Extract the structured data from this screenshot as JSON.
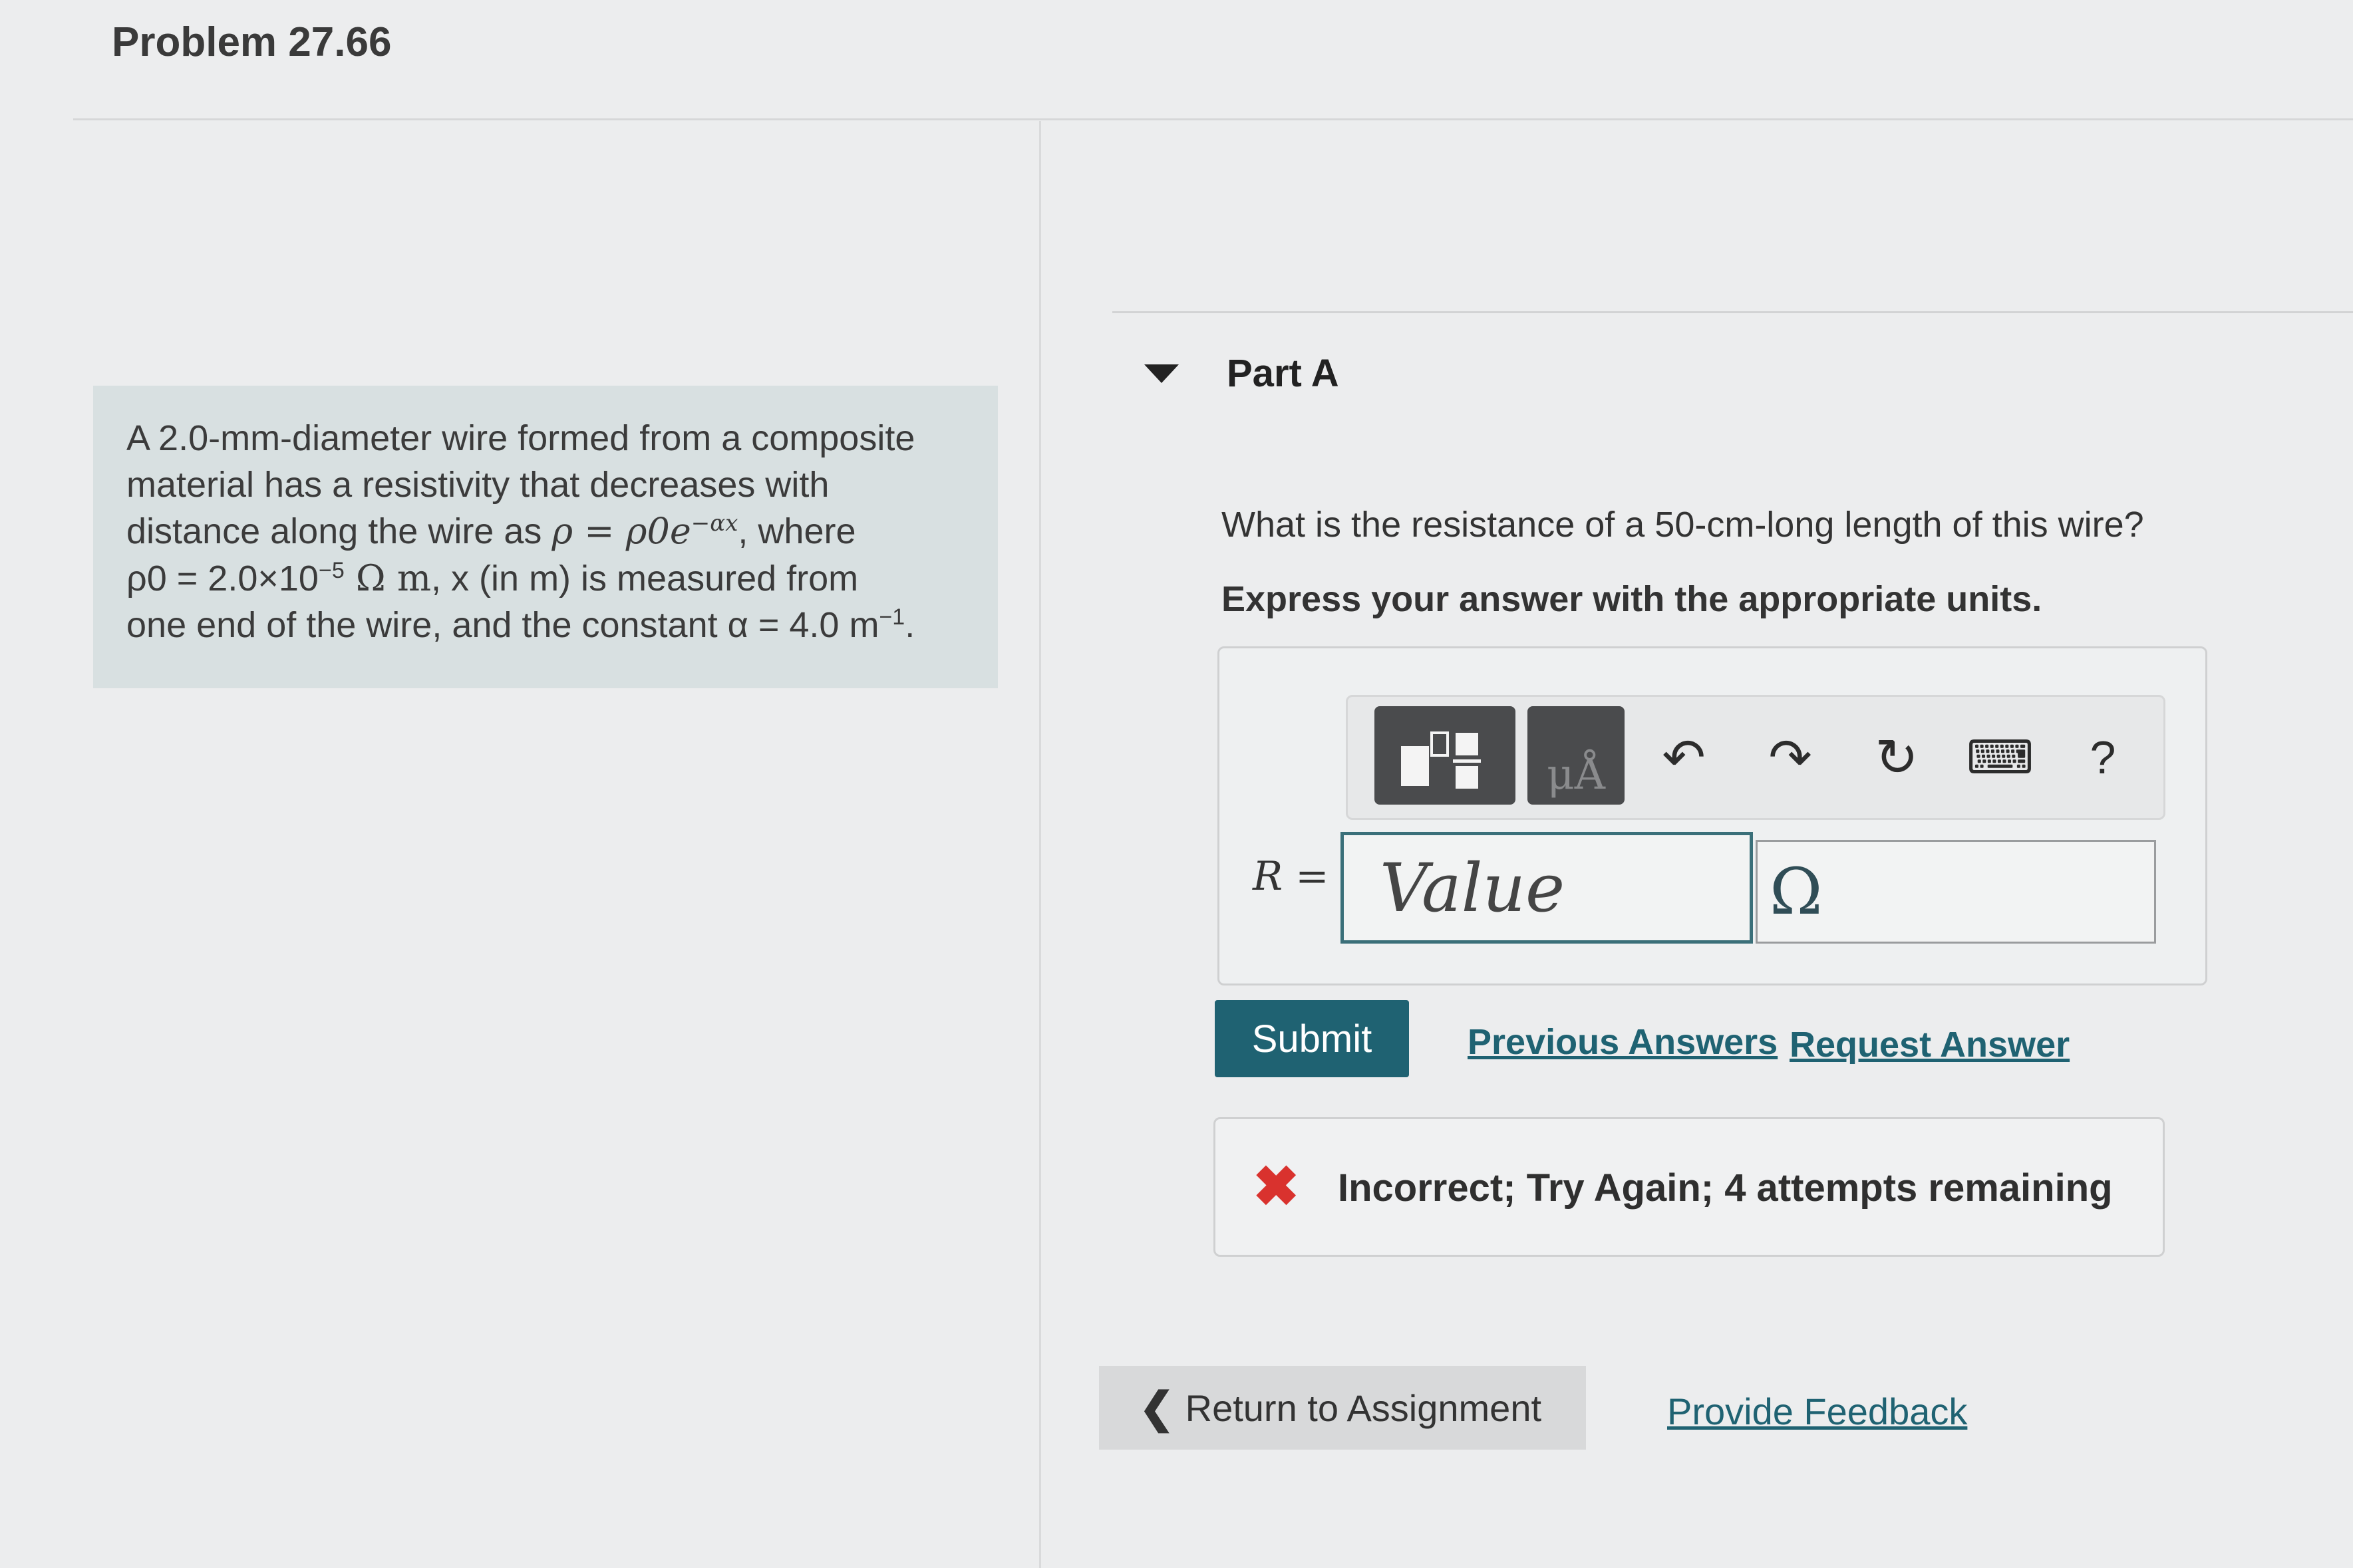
{
  "header": {
    "problem_title": "Problem 27.66"
  },
  "problem": {
    "line1": "A 2.0-mm-diameter wire formed from a composite",
    "line2": "material has a resistivity that decreases with",
    "line3_pre": "distance along the wire as ",
    "line3_formula": "ρ = ρ0e",
    "line3_exp": "−αx",
    "line3_post": ", where",
    "line4_rho0": "ρ0 = 2.0×10",
    "line4_exp": "−5",
    "line4_unit": " Ω m",
    "line4_post": ", x (in m) is measured from",
    "line5_pre": "one end of the wire, and the constant ",
    "line5_alpha": "α = 4.0 m",
    "line5_exp": "−1",
    "line5_post": "."
  },
  "part": {
    "title": "Part A",
    "question": "What is the resistance of a 50-cm-long length of this wire?",
    "instructions": "Express your answer with the appropriate units."
  },
  "toolbar": {
    "units_glyph": "μÅ",
    "undo": "↶",
    "redo": "↷",
    "reset": "↻",
    "keyboard": "⌨",
    "help": "?"
  },
  "answer": {
    "variable": "R",
    "equals": " =",
    "value_placeholder": "Value",
    "units_value": "Ω"
  },
  "actions": {
    "submit": "Submit",
    "previous_answers": "Previous Answers",
    "request_answer": "Request Answer"
  },
  "feedback": {
    "icon": "✖",
    "message": "Incorrect; Try Again; 4 attempts remaining"
  },
  "footer": {
    "return_chevron": "❮",
    "return": "Return to Assignment",
    "provide_feedback": "Provide Feedback"
  },
  "colors": {
    "accent": "#1f6272",
    "error": "#d9322e",
    "problem_box_bg": "#d8e0e1"
  }
}
